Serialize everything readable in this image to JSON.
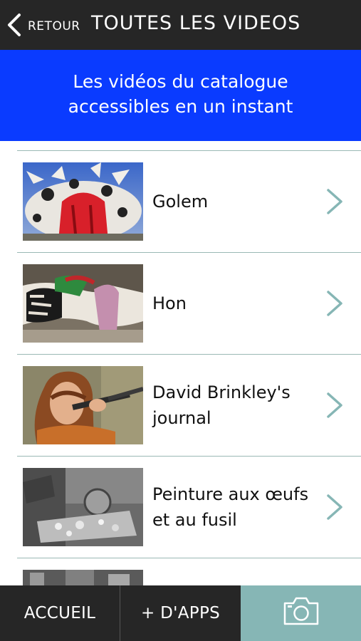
{
  "header": {
    "back_label": "RETOUR",
    "title": "TOUTES LES VIDEOS"
  },
  "banner": {
    "line1": "Les vidéos du catalogue",
    "line2": "accessibles en un instant"
  },
  "videos": [
    {
      "line1": "Golem",
      "line2": ""
    },
    {
      "line1": "Hon",
      "line2": ""
    },
    {
      "line1": "David Brinkley's",
      "line2": "journal"
    },
    {
      "line1": "Peinture aux œufs",
      "line2": "et au fusil"
    }
  ],
  "footer": {
    "home_label": "ACCUEIL",
    "apps_label": "+ D'APPS",
    "camera_icon": "camera-icon"
  },
  "colors": {
    "top_bar": "#262626",
    "banner": "#0a3bff",
    "divider": "#9ab8b4",
    "chevron": "#86b6b5",
    "camera_tab": "#86b6b5"
  }
}
